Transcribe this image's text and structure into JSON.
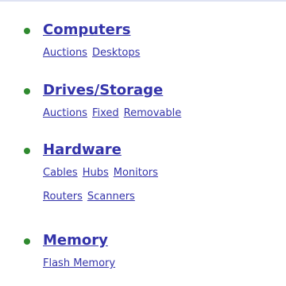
{
  "colors": {
    "link": "#3333aa",
    "bullet": "#2f8a2f",
    "rule": "#dfe3f3"
  },
  "categories": [
    {
      "title": "Computers",
      "subs": [
        [
          "Auctions",
          "Desktops"
        ]
      ]
    },
    {
      "title": "Drives/Storage",
      "subs": [
        [
          "Auctions",
          "Fixed",
          "Removable"
        ]
      ]
    },
    {
      "title": "Hardware",
      "subs": [
        [
          "Cables",
          "Hubs",
          "Monitors"
        ],
        [
          "Routers",
          "Scanners"
        ]
      ]
    },
    {
      "title": "Memory",
      "subs": [
        [
          "Flash Memory"
        ]
      ]
    }
  ]
}
